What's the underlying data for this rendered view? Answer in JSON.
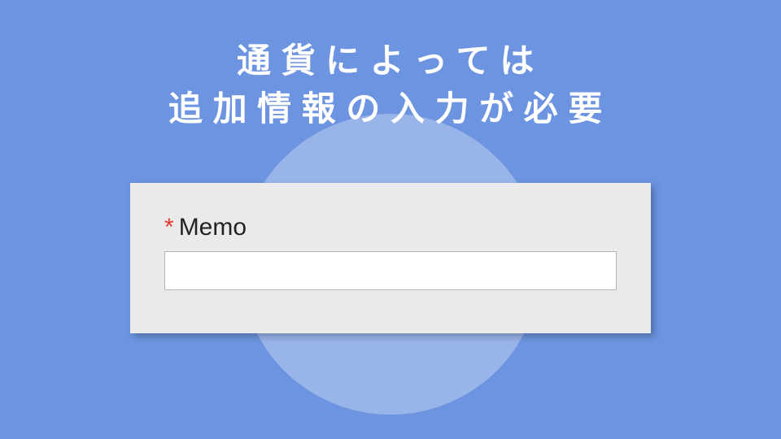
{
  "heading": {
    "line1": "通貨によっては",
    "line2": "追加情報の入力が必要"
  },
  "form": {
    "requiredMark": "*",
    "fieldLabel": "Memo",
    "inputValue": ""
  },
  "colors": {
    "background": "#6c94e0",
    "circle": "rgba(255,255,255,0.3)",
    "card": "#eaeaea",
    "required": "#e53935"
  }
}
